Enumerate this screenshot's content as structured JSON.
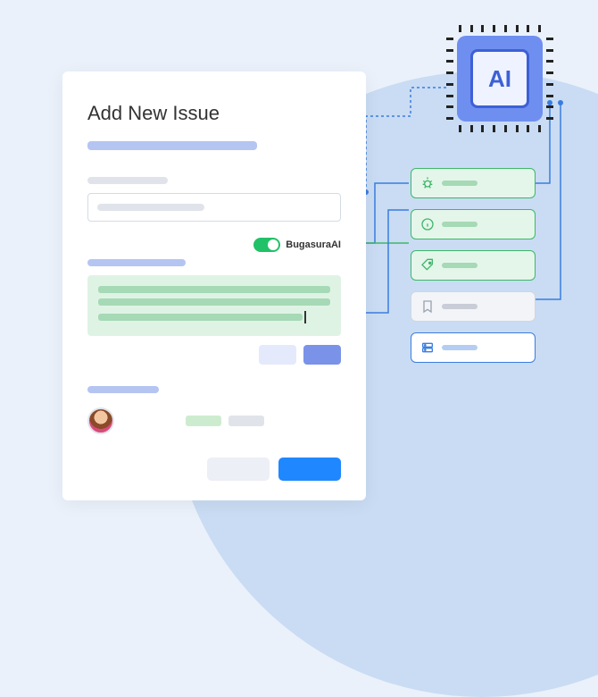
{
  "form": {
    "title": "Add New Issue",
    "ai_toggle_label": "BugasuraAI",
    "ai_enabled": true
  },
  "ai_chip": {
    "label": "AI"
  },
  "suggestions": [
    {
      "id": "bug",
      "icon": "bug-icon",
      "style": "green"
    },
    {
      "id": "info",
      "icon": "info-icon",
      "style": "green"
    },
    {
      "id": "tag",
      "icon": "tag-icon",
      "style": "green"
    },
    {
      "id": "bookmark",
      "icon": "bookmark-icon",
      "style": "gray"
    },
    {
      "id": "server",
      "icon": "server-icon",
      "style": "blue"
    }
  ],
  "colors": {
    "accent_blue": "#1f87ff",
    "ai_blue": "#3d60d6",
    "toggle_green": "#21c168",
    "suggestion_green": "#3fb66a"
  }
}
